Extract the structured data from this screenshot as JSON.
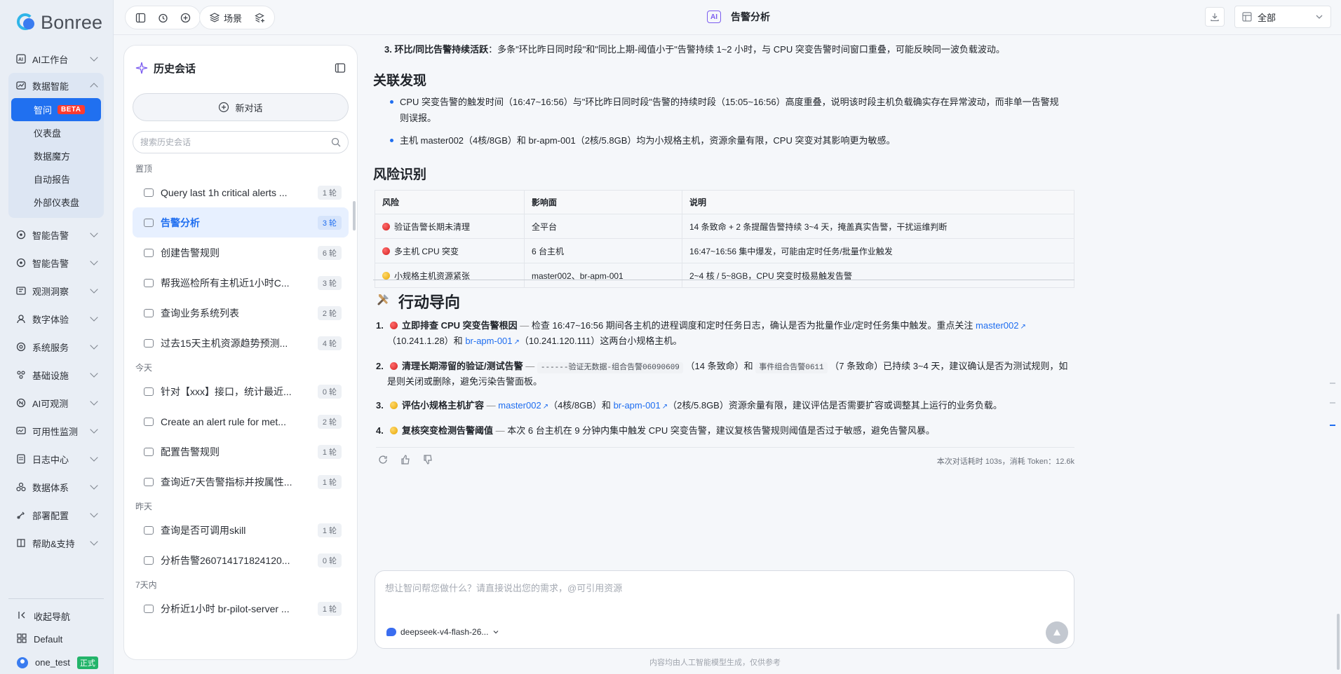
{
  "brand": {
    "name": "Bonree"
  },
  "nav": {
    "items": [
      {
        "label": "AI工作台",
        "icon": "ai-icon"
      },
      {
        "label": "数据智能",
        "icon": "data-icon",
        "expanded": true,
        "children": [
          {
            "label": "智问",
            "badge": "BETA",
            "active": true
          },
          {
            "label": "仪表盘"
          },
          {
            "label": "数据魔方"
          },
          {
            "label": "自动报告"
          },
          {
            "label": "外部仪表盘"
          }
        ]
      },
      {
        "label": "智能告警",
        "icon": "alert-icon"
      },
      {
        "label": "智能告警",
        "icon": "alert-icon"
      },
      {
        "label": "观测洞察",
        "icon": "observe-icon"
      },
      {
        "label": "数字体验",
        "icon": "user-icon"
      },
      {
        "label": "系统服务",
        "icon": "service-icon"
      },
      {
        "label": "基础设施",
        "icon": "infra-icon"
      },
      {
        "label": "AI可观测",
        "icon": "ai-observe-icon"
      },
      {
        "label": "可用性监测",
        "icon": "monitor-icon"
      },
      {
        "label": "日志中心",
        "icon": "log-icon"
      },
      {
        "label": "数据体系",
        "icon": "data-system-icon"
      },
      {
        "label": "部署配置",
        "icon": "deploy-icon"
      },
      {
        "label": "帮助&支持",
        "icon": "help-icon"
      }
    ],
    "collapse_label": "收起导航",
    "workspace": "Default",
    "user": "one_test",
    "user_tag": "正式"
  },
  "topbar": {
    "scene_label": "场景",
    "title": "告警分析",
    "ai_badge": "AI",
    "select_value": "全部"
  },
  "history": {
    "title": "历史会话",
    "new_chat": "新对话",
    "search_placeholder": "搜索历史会话",
    "sections": [
      {
        "label": "置顶",
        "items": [
          {
            "text": "Query last 1h critical alerts ...",
            "count": "1 轮"
          },
          {
            "text": "告警分析",
            "count": "3 轮",
            "active": true
          },
          {
            "text": "创建告警规则",
            "count": "6 轮"
          },
          {
            "text": "帮我巡检所有主机近1小时C...",
            "count": "3 轮"
          },
          {
            "text": "查询业务系统列表",
            "count": "2 轮"
          },
          {
            "text": "过去15天主机资源趋势预测...",
            "count": "4 轮"
          }
        ]
      },
      {
        "label": "今天",
        "items": [
          {
            "text": "针对【xxx】接口，统计最近...",
            "count": "0 轮"
          },
          {
            "text": "Create an alert rule for met...",
            "count": "2 轮"
          },
          {
            "text": "配置告警规则",
            "count": "1 轮"
          },
          {
            "text": "查询近7天告警指标并按属性...",
            "count": "1 轮"
          }
        ]
      },
      {
        "label": "昨天",
        "items": [
          {
            "text": "查询是否可调用skill",
            "count": "1 轮"
          },
          {
            "text": "分析告警2607141718241​20...",
            "count": "0 轮"
          }
        ]
      },
      {
        "label": "7天内",
        "items": [
          {
            "text": "分析近1小时 br-pilot-server ...",
            "count": "1 轮"
          }
        ]
      }
    ]
  },
  "content": {
    "top_line_bold": "3. 环比/同比告警持续活跃",
    "top_line_rest": "：多条\"环比昨日同时段\"和\"同比上期-阈值小于\"告警持续 1~2 小时，与 CPU 突变告警时间窗口重叠，可能反映同一波负载波动。",
    "related_title": "关联发现",
    "related": [
      "CPU 突变告警的触发时间（16:47~16:56）与\"环比昨日同时段\"告警的持续时段（15:05~16:56）高度重叠，说明该时段主机负载确实存在异常波动，而非单一告警规则误报。",
      "主机 master002（4核/8GB）和 br-apm-001（2核/5.8GB）均为小规格主机，资源余量有限，CPU 突变对其影响更为敏感。"
    ],
    "risk_title": "风险识别",
    "risk_headers": [
      "风险",
      "影响面",
      "说明"
    ],
    "risk_rows": [
      {
        "level": "red",
        "risk": "验证告警长期未清理",
        "scope": "全平台",
        "desc": "14 条致命 + 2 条提醒告警持续 3~4 天，掩盖真实告警，干扰运维判断"
      },
      {
        "level": "red",
        "risk": "多主机 CPU 突变",
        "scope": "6 台主机",
        "desc": "16:47~16:56 集中爆发，可能由定时任务/批量作业触发"
      },
      {
        "level": "yellow",
        "risk": "小规格主机资源紧张",
        "scope": "master002、br-apm-001",
        "desc": "2~4 核 / 5~8GB，CPU 突变时极易触发告警"
      }
    ],
    "action_title": "行动导向",
    "actions": [
      {
        "num": "1.",
        "level": "red",
        "title": "立即排查 CPU 突变告警根因",
        "text": "检查 16:47~16:56 期间各主机的进程调度和定时任务日志，确认是否为批量作业/定时任务集中触发。重点关注",
        "link1": "master002",
        "mid1": "（10.241.1.28）和",
        "link2": "br-apm-001",
        "tail": "（10.241.120.111）这两台小规格主机。"
      },
      {
        "num": "2.",
        "level": "red",
        "title": "清理长期滞留的验证/测试告警",
        "code1": "------验证无数据-组合告警06090609",
        "mid1": "（14 条致命）和",
        "code2": "事件组合告警0611",
        "tail": "（7 条致命）已持续 3~4 天，建议确认是否为测试规则，如是则关闭或删除，避免污染告警面板。"
      },
      {
        "num": "3.",
        "level": "yellow",
        "title": "评估小规格主机扩容",
        "link1": "master002",
        "mid1": "（4核/8GB）和",
        "link2": "br-apm-001",
        "tail": "（2核/5.8GB）资源余量有限，建议评估是否需要扩容或调整其上运行的业务负载。"
      },
      {
        "num": "4.",
        "level": "yellow",
        "title": "复核突变检测告警阈值",
        "tail": "本次 6 台主机在 9 分钟内集中触发 CPU 突变告警，建议复核告警规则阈值是否过于敏感，避免告警风暴。"
      }
    ],
    "stats": "本次对话耗时 103s，消耗 Token：12.6k"
  },
  "composer": {
    "placeholder": "想让智问帮您做什么？请直接说出您的需求，@可引用资源",
    "model": "deepseek-v4-flash-26..."
  },
  "footnote": "内容均由人工智能模型生成，仅供参考",
  "colors": {
    "accent": "#1f6ef0",
    "beta": "#ff3b30",
    "tag": "#23b46a"
  }
}
